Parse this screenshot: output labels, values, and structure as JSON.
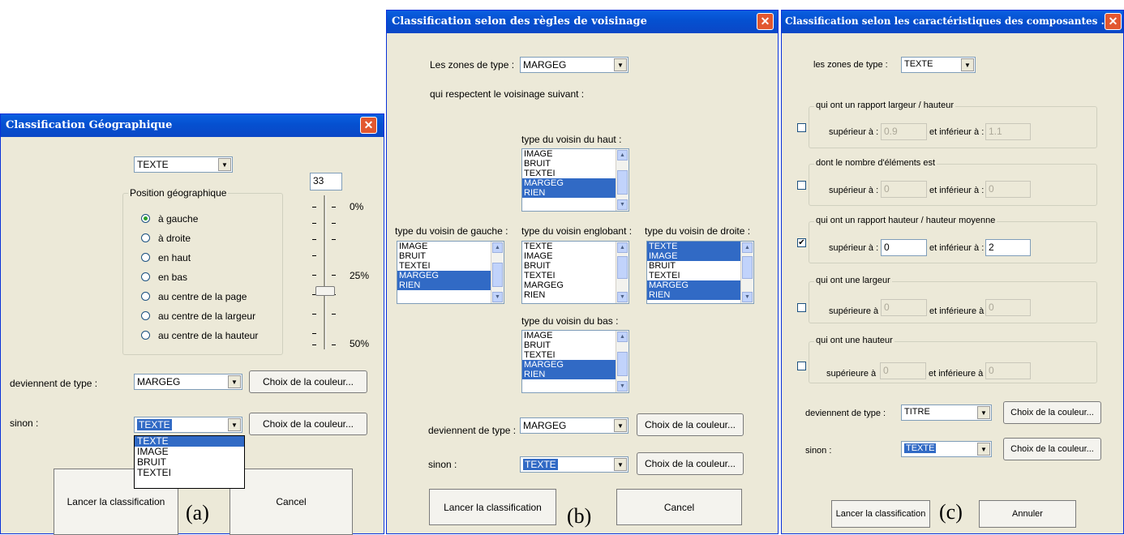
{
  "panel_a": {
    "title": "Classification Géographique",
    "type_value": "TEXTE",
    "slider_value": "33",
    "group_label": "Position géographique",
    "radios": [
      "à gauche",
      "à droite",
      "en haut",
      "en bas",
      "au centre de la page",
      "au centre de la largeur",
      "au centre de la hauteur"
    ],
    "selected_radio": "à gauche",
    "ticks": [
      "0%",
      "25%",
      "50%"
    ],
    "slider_level": 0.25,
    "deviennent_label": "deviennent de type :",
    "deviennent_value": "MARGEG",
    "color_button": "Choix de la couleur...",
    "sinon_label": "sinon :",
    "sinon_value": "TEXTE",
    "dropdown_options": [
      "TEXTE",
      "IMAGE",
      "BRUIT",
      "TEXTEI"
    ],
    "run_button": "Lancer la classification",
    "cancel_button": "Cancel",
    "caption": "(a)"
  },
  "panel_b": {
    "title": "Classification selon des règles de voisinage",
    "zones_label": "Les zones de type :",
    "zones_value": "MARGEG",
    "respect_label": "qui respectent le voisinage suivant :",
    "haut_label": "type du voisin du haut :",
    "haut_items": [
      "IMAGE",
      "BRUIT",
      "TEXTEI",
      "MARGEG",
      "RIEN"
    ],
    "gauche_label": "type du voisin de gauche :",
    "gauche_items": [
      "IMAGE",
      "BRUIT",
      "TEXTEI",
      "MARGEG",
      "RIEN"
    ],
    "englobant_label": "type du voisin englobant :",
    "englobant_items": [
      "TEXTE",
      "IMAGE",
      "BRUIT",
      "TEXTEI",
      "MARGEG",
      "RIEN"
    ],
    "droite_label": "type du voisin de droite :",
    "droite_items": [
      "TEXTE",
      "IMAGE",
      "BRUIT",
      "TEXTEI",
      "MARGEG",
      "RIEN"
    ],
    "bas_label": "type du voisin du bas :",
    "bas_items": [
      "IMAGE",
      "BRUIT",
      "TEXTEI",
      "MARGEG",
      "RIEN"
    ],
    "deviennent_label": "deviennent de type :",
    "deviennent_value": "MARGEG",
    "color_button": "Choix de la couleur...",
    "sinon_label": "sinon :",
    "sinon_value": "TEXTE",
    "run_button": "Lancer la classification",
    "cancel_button": "Cancel",
    "caption": "(b)"
  },
  "panel_c": {
    "title": "Classification selon les caractéristiques des composantes ...",
    "zones_label": "les zones de type :",
    "zones_value": "TEXTE",
    "groups": [
      {
        "label": "qui ont un rapport largeur / hauteur",
        "sup_label": "supérieur à :",
        "sup_value": "0.9",
        "inf_label": "et inférieur à :",
        "inf_value": "1.1",
        "checked": false
      },
      {
        "label": "dont le nombre d'éléments est",
        "sup_label": "supérieur à :",
        "sup_value": "0",
        "inf_label": "et inférieur à :",
        "inf_value": "0",
        "checked": false
      },
      {
        "label": "qui ont un rapport hauteur / hauteur moyenne",
        "sup_label": "supérieur à :",
        "sup_value": "0",
        "inf_label": "et inférieur à :",
        "inf_value": "2",
        "checked": true
      },
      {
        "label": "qui ont une largeur",
        "sup_label": "supérieure à",
        "sup_value": "0",
        "inf_label": "et inférieure à",
        "inf_value": "0",
        "checked": false
      },
      {
        "label": "qui ont une hauteur",
        "sup_label": "supérieure à",
        "sup_value": "0",
        "inf_label": "et inférieure à",
        "inf_value": "0",
        "checked": false
      }
    ],
    "check_mark": "✔",
    "deviennent_label": "deviennent de type :",
    "deviennent_value": "TITRE",
    "color_button": "Choix de la couleur...",
    "sinon_label": "sinon :",
    "sinon_value": "TEXTE",
    "run_button": "Lancer la classification",
    "cancel_button": "Annuler",
    "caption": "(c)"
  },
  "close_glyph": "✕",
  "arrow_down": "▼",
  "arrow_up": "▲"
}
